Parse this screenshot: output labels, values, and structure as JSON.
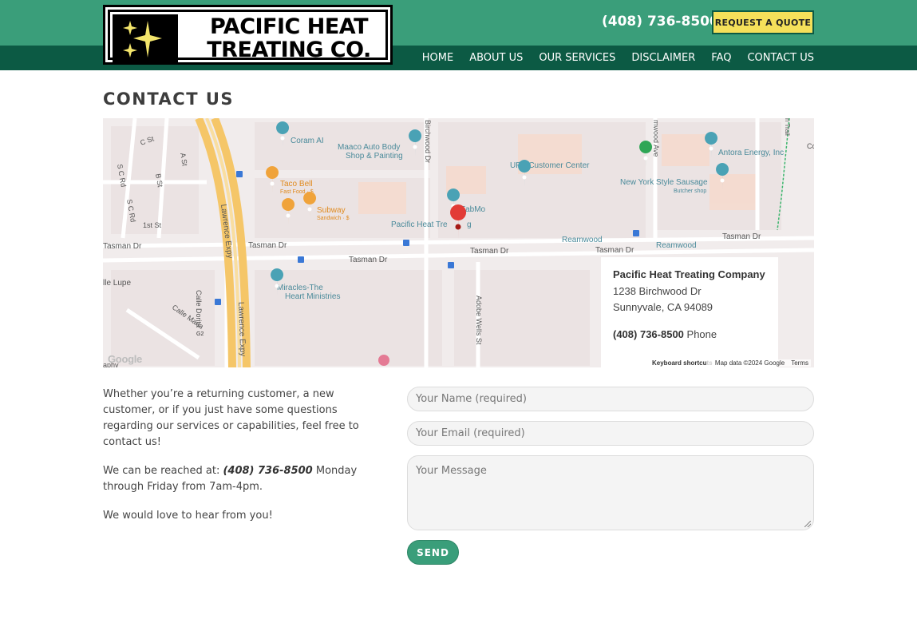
{
  "header": {
    "logo_line1": "PACIFIC HEAT",
    "logo_line2": "TREATING CO.",
    "phone": "(408) 736-8500",
    "quote_label": "REQUEST A QUOTE",
    "nav": [
      {
        "label": "HOME"
      },
      {
        "label": "ABOUT US"
      },
      {
        "label": "OUR SERVICES"
      },
      {
        "label": "DISCLAIMER"
      },
      {
        "label": "FAQ"
      },
      {
        "label": "CONTACT US"
      }
    ]
  },
  "page": {
    "title": "CONTACT US"
  },
  "map": {
    "labels": {
      "coram": "Coram AI",
      "maaco1": "Maaco Auto Body",
      "maaco2": "Shop & Painting",
      "ups": "UPS Customer Center",
      "antora": "Antora Energy, Inc",
      "nysausage": "New York Style Sausage",
      "butcher": "Butcher shop",
      "tacobell": "Taco Bell",
      "fastfood": "Fast Food · $",
      "subway": "Subway",
      "sandwich": "Sandwich · $",
      "fabmo": "FabMo",
      "pht": "Pacific Heat Tre",
      "pht_tail": "g",
      "tasman": "Tasman Dr",
      "reamwood": "Reamwood",
      "lawrence": "Lawrence Expy",
      "birchwood": "Birchwood Dr",
      "wood_ave": "mwood Ave",
      "miracles1": "Miracles-The",
      "miracles2": "Heart Ministries",
      "calle_dorita": "Calle Dorita",
      "calle_maria": "Calle Maria",
      "adobe": "Adobe Wells St",
      "lupe": "lle Lupe",
      "c_st": "C St",
      "a_st": "A St",
      "b_st": "B St",
      "s_c_rd": "S C Rd",
      "s_c_rd2": "S C Rd",
      "first_st": "1st St",
      "g2": "G2",
      "trail": "n Trail",
      "co": "Co",
      "aphy": "aphy"
    },
    "card": {
      "name": "Pacific Heat Treating Company",
      "addr1": "1238 Birchwood Dr",
      "addr2": "Sunnyvale, CA 94089",
      "phone": "(408) 736-8500",
      "phone_suffix": " Phone"
    },
    "google": "Google",
    "kbd": "Keyboard shortcuts",
    "mapdata": "Map data ©2024 Google",
    "terms": "Terms"
  },
  "content": {
    "para1": "Whether you’re a returning customer, a new customer, or if you just have some questions regarding our services or capabilities, feel free to contact us!",
    "para2_pre": "We can be reached at: ",
    "para2_phone": "(408) 736-8500",
    "para2_post": " Monday through Friday from 7am-4pm.",
    "para3": "We would love to hear from you!"
  },
  "form": {
    "name_placeholder": "Your Name (required)",
    "email_placeholder": "Your Email (required)",
    "message_placeholder": "Your Message",
    "send_label": "SEND"
  },
  "colors": {
    "header_green": "#3a9e7a",
    "nav_dark_green": "#0c5a44",
    "quote_yellow": "#f5e05a",
    "send_green": "#3a9e7a"
  }
}
